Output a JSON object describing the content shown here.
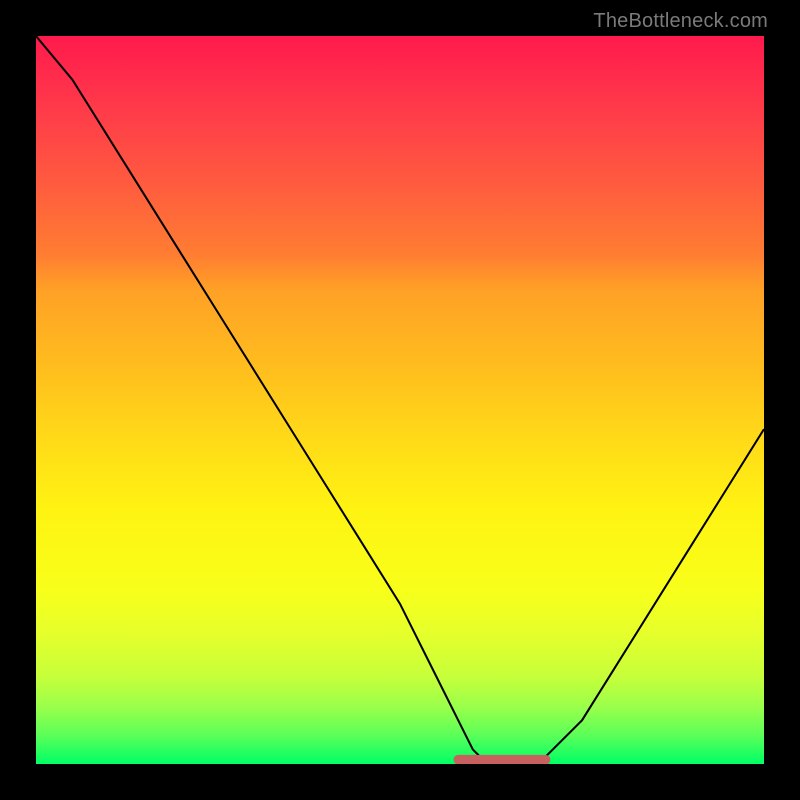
{
  "watermark": "TheBottleneck.com",
  "colors": {
    "curve": "#000000",
    "marker": "#c96060",
    "gradient_top": "#ff1a4d",
    "gradient_mid": "#ffe018",
    "gradient_bottom": "#00ff66",
    "frame": "#000000"
  },
  "chart_data": {
    "type": "line",
    "title": "",
    "xlabel": "",
    "ylabel": "",
    "xlim": [
      0,
      100
    ],
    "ylim": [
      0,
      100
    ],
    "grid": false,
    "legend": "none",
    "x": [
      0,
      5,
      10,
      15,
      20,
      25,
      30,
      35,
      40,
      45,
      50,
      55,
      58,
      60,
      62,
      65,
      68,
      70,
      75,
      80,
      85,
      90,
      95,
      100
    ],
    "values": [
      100,
      94,
      86,
      78,
      70,
      62,
      54,
      46,
      38,
      30,
      22,
      12,
      6,
      2,
      0,
      0,
      0,
      1,
      6,
      14,
      22,
      30,
      38,
      46
    ],
    "trough_markers_x": [
      58,
      60,
      62,
      64,
      66,
      68,
      70
    ],
    "note": "x and y are normalized 0–100; axes have no tick labels in the source image so values are estimated from geometry."
  }
}
